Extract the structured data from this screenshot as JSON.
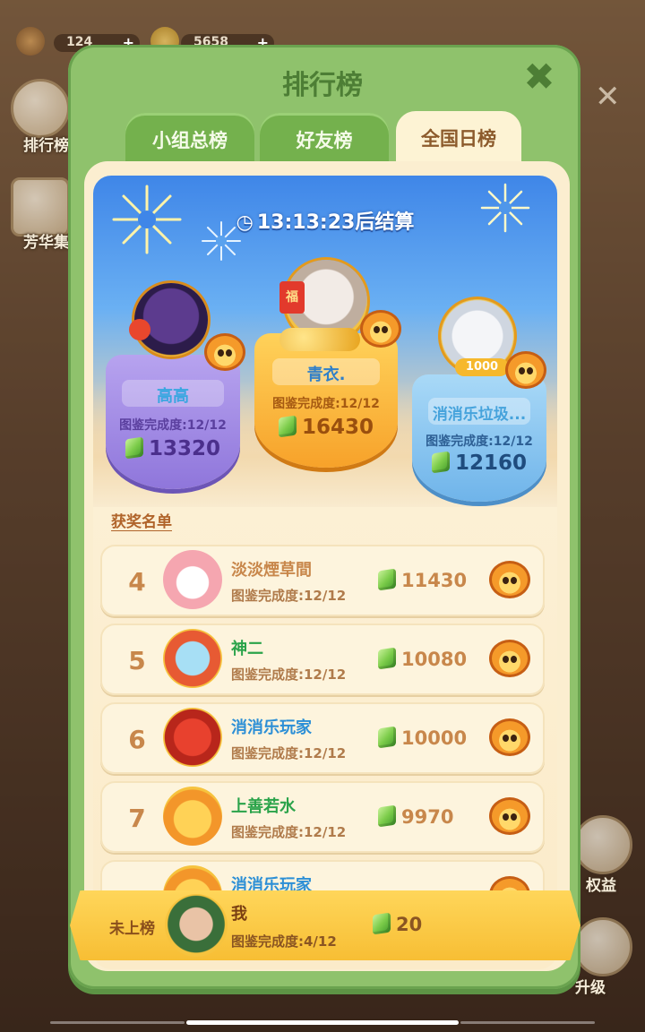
{
  "background": {
    "lives": "124",
    "coins": "5658",
    "side_leaderboard_label": "排行榜",
    "side_collection_label": "芳华集",
    "side_rights_label": "权益",
    "side_upgrade_label": "升级"
  },
  "modal": {
    "title": "排行榜",
    "tabs": [
      {
        "label": "小组总榜",
        "active": false
      },
      {
        "label": "好友榜",
        "active": false
      },
      {
        "label": "全国日榜",
        "active": true
      }
    ],
    "timer": "13:13:23后结算"
  },
  "podium": [
    {
      "place": 1,
      "name": "青衣.",
      "progress": "图鉴完成度:12/12",
      "score": "16430",
      "name_color": "#2f7fc9"
    },
    {
      "place": 2,
      "name": "高高",
      "progress": "图鉴完成度:12/12",
      "score": "13320",
      "name_color": "#3aa6e0"
    },
    {
      "place": 3,
      "name": "消消乐垃圾...",
      "progress": "图鉴完成度:12/12",
      "score": "12160",
      "name_color": "#46a3dc"
    }
  ],
  "award_list_title": "获奖名单",
  "rows": [
    {
      "rank": "4",
      "name": "淡淡煙草間",
      "progress": "图鉴完成度:12/12",
      "score": "11430",
      "name_color": "#c8874b"
    },
    {
      "rank": "5",
      "name": "神二",
      "progress": "图鉴完成度:12/12",
      "score": "10080",
      "name_color": "#2aa34a"
    },
    {
      "rank": "6",
      "name": "消消乐玩家",
      "progress": "图鉴完成度:12/12",
      "score": "10000",
      "name_color": "#2c8fd6"
    },
    {
      "rank": "7",
      "name": "上善若水",
      "progress": "图鉴完成度:12/12",
      "score": "9970",
      "name_color": "#2aa34a"
    },
    {
      "rank": "",
      "name": "消消乐玩家",
      "progress": "",
      "score": "",
      "name_color": "#2c8fd6"
    }
  ],
  "my_rank": {
    "rank_label": "未上榜",
    "name": "我",
    "progress": "图鉴完成度:4/12",
    "score": "20"
  },
  "badge_1000": "1000"
}
